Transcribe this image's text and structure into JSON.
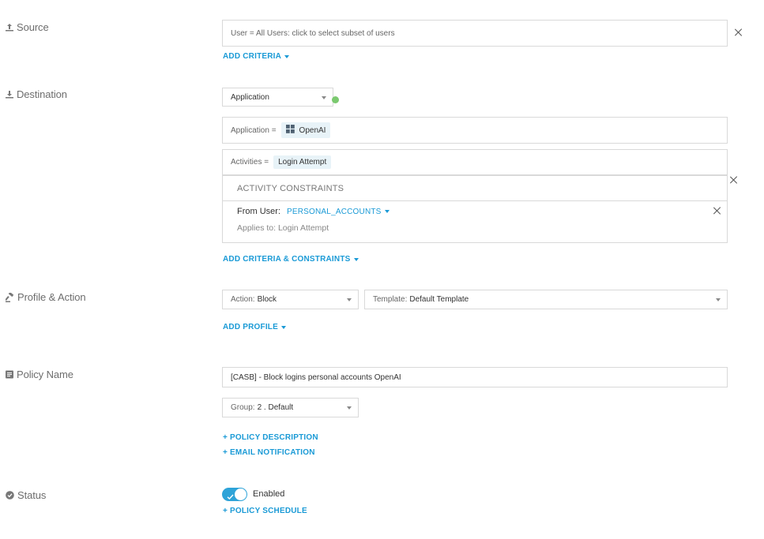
{
  "sections": {
    "source": "Source",
    "destination": "Destination",
    "profile_action": "Profile & Action",
    "policy_name": "Policy Name",
    "status": "Status"
  },
  "source": {
    "user_field": "User = All Users: click to select subset of users",
    "add_criteria": "ADD CRITERIA"
  },
  "destination": {
    "type_select": "Application",
    "app_label": "Application =",
    "app_value": "OpenAI",
    "activities_label": "Activities =",
    "activities_value": "Login Attempt",
    "constraints_header": "ACTIVITY CONSTRAINTS",
    "from_user_label": "From User:",
    "from_user_value": "PERSONAL_ACCOUNTS",
    "applies_to": "Applies to: Login Attempt",
    "add_criteria_constraints": "ADD CRITERIA & CONSTRAINTS"
  },
  "profile_action": {
    "action_label": "Action:",
    "action_value": "Block",
    "template_label": "Template:",
    "template_value": "Default Template",
    "add_profile": "ADD PROFILE"
  },
  "policy": {
    "name_value": "[CASB] - Block logins personal accounts OpenAI",
    "group_label": "Group:",
    "group_value": "2 . Default",
    "policy_description": "+ POLICY DESCRIPTION",
    "email_notification": "+ EMAIL NOTIFICATION"
  },
  "status": {
    "toggle_label": "Enabled",
    "enabled": true,
    "policy_schedule": "+ POLICY SCHEDULE"
  },
  "colors": {
    "accent": "#1a9ad6",
    "toggle": "#2ea3d8",
    "status_dot": "#7bc96f",
    "chip_bg": "#e8f3f8"
  }
}
